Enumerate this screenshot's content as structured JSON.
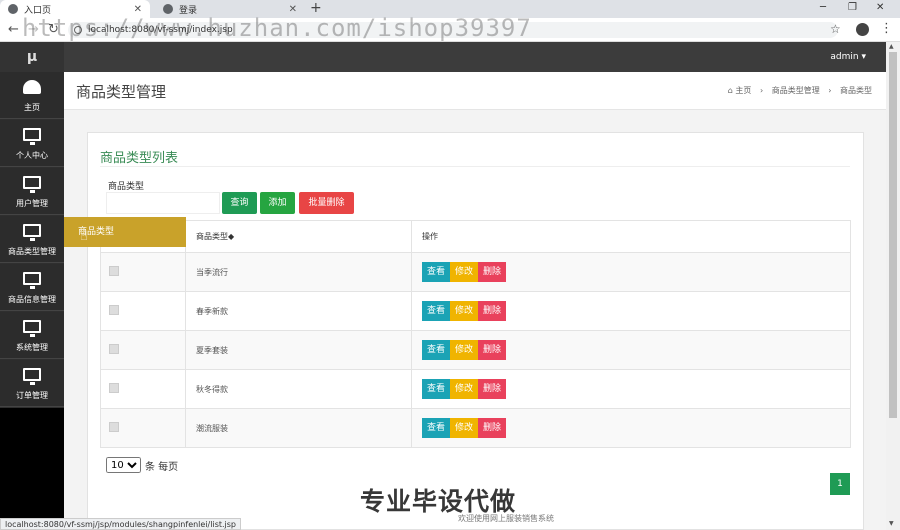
{
  "browser": {
    "tabs": [
      {
        "label": "入口页",
        "close": "✕"
      },
      {
        "label": "登录",
        "close": "✕"
      }
    ],
    "new_tab": "+",
    "window_controls": [
      "─",
      "❐",
      "✕"
    ],
    "url": "localhost:8080/vf-ssmj/index.jsp",
    "watermark": "https://www.huzhan.com/ishop39397"
  },
  "topnav": {
    "brand": "μ",
    "user": "admin ▾"
  },
  "sidebar": {
    "items": [
      {
        "label": "主页",
        "icon": "dashboard-icon"
      },
      {
        "label": "个人中心",
        "icon": "monitor-icon"
      },
      {
        "label": "用户管理",
        "icon": "monitor-icon"
      },
      {
        "label": "商品类型管理",
        "icon": "monitor-icon"
      },
      {
        "label": "商品信息管理",
        "icon": "monitor-icon"
      },
      {
        "label": "系统管理",
        "icon": "monitor-icon"
      },
      {
        "label": "订单管理",
        "icon": "monitor-icon"
      }
    ],
    "flyout": "商品类型"
  },
  "header": {
    "title": "商品类型管理",
    "breadcrumb": [
      "主页",
      "商品类型管理",
      "商品类型"
    ]
  },
  "panel": {
    "title": "商品类型列表",
    "search_label": "商品类型",
    "search_value": "",
    "query_label": "查询",
    "add_label": "添加",
    "batch_delete_label": "批量删除"
  },
  "table": {
    "columns": [
      "",
      "商品类型◆",
      "操作"
    ],
    "rows": [
      {
        "type": "当季流行"
      },
      {
        "type": "春季新款"
      },
      {
        "type": "夏季套装"
      },
      {
        "type": "秋冬得款"
      },
      {
        "type": "潮流服装"
      }
    ],
    "actions": {
      "view": "查看",
      "edit": "修改",
      "delete": "删除"
    }
  },
  "pagination": {
    "page_size": "10",
    "page_size_suffix": "条 每页",
    "current_page": "1"
  },
  "footer": {
    "note": "欢迎使用网上服装销售系统",
    "watermark": "专业毕设代做",
    "status_url": "localhost:8080/vf-ssmj/jsp/modules/shangpinfenlei/list.jsp"
  },
  "colors": {
    "accent_green": "#1f9b55",
    "danger_red": "#e84545",
    "flyout_gold": "#c9a22a",
    "view_teal": "#1ba3b5",
    "edit_yellow": "#f0b400"
  }
}
